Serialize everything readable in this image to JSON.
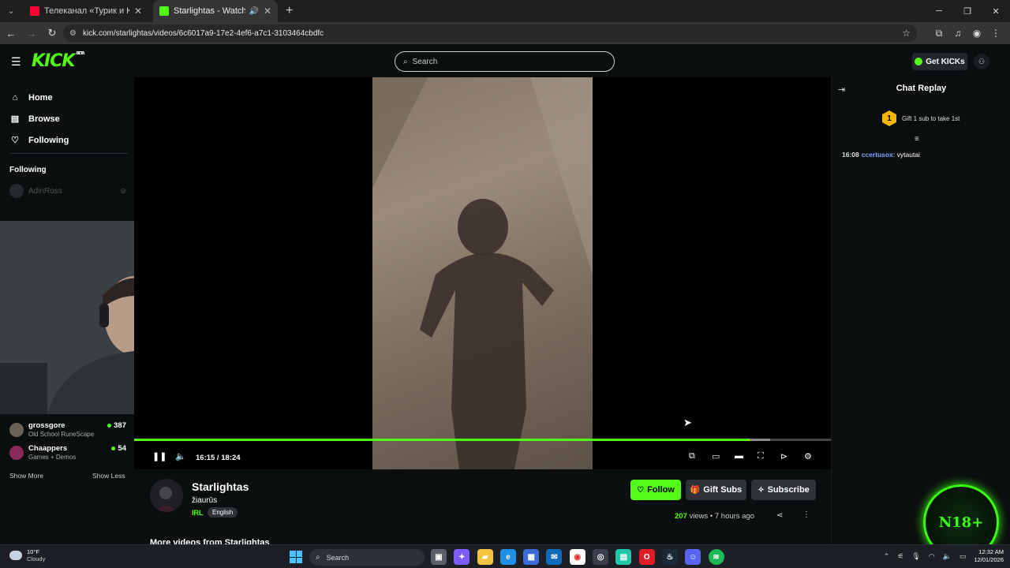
{
  "browser": {
    "tabs": [
      {
        "title": "Телеканал «Турик и Конюшня»",
        "favicon_color": "#ff0033",
        "active": false
      },
      {
        "title": "Starlightas - Watch the VOD",
        "favicon_color": "#53fc18",
        "active": true
      }
    ],
    "url": "kick.com/starlightas/videos/6c6017a9-17e2-4ef6-a7c1-3103464cbdfc"
  },
  "header": {
    "logo": "KICK",
    "logo_badge": "BETA",
    "search_placeholder": "Search",
    "get_kicks_label": "Get KICKs"
  },
  "sidebar": {
    "nav": [
      {
        "label": "Home",
        "icon": "home-icon"
      },
      {
        "label": "Browse",
        "icon": "browse-icon"
      },
      {
        "label": "Following",
        "icon": "heart-icon"
      }
    ],
    "following_title": "Following",
    "following": [
      {
        "name": "AdinRoss",
        "offline": true
      }
    ],
    "recommended": [
      {
        "name": "grossgore",
        "category": "Old School RuneScape",
        "viewers": "387"
      },
      {
        "name": "Chaappers",
        "category": "Games + Demos",
        "viewers": "54"
      }
    ],
    "show_more": "Show More",
    "show_less": "Show Less"
  },
  "player": {
    "current_time": "16:15",
    "duration": "18:24",
    "time_display": "16:15 / 18:24",
    "progress_fraction": 0.883,
    "buffered_fraction": 0.913
  },
  "channel": {
    "name": "Starlightas",
    "stream_title": "žiaurūs",
    "category": "IRL",
    "language": "English",
    "follow_label": "Follow",
    "gift_subs_label": "Gift Subs",
    "subscribe_label": "Subscribe",
    "views_count": "207",
    "views_word": "views",
    "age": "7 hours ago",
    "more_videos_title": "More videos from Starlightas"
  },
  "chat": {
    "title": "Chat Replay",
    "gift_prompt": "Gift 1 sub to take 1st",
    "gift_rank": "1",
    "messages": [
      {
        "time": "16:08",
        "user": "ccertusox",
        "text": "vytautai"
      }
    ]
  },
  "overlay": {
    "badge_text": "N18+"
  },
  "taskbar": {
    "temperature": "10°F",
    "condition": "Cloudy",
    "search_label": "Search",
    "time": "12:32 AM",
    "date": "12/01/2026"
  },
  "colors": {
    "accent": "#53fc18",
    "background": "#0b0e0f",
    "chat_username": "#7aa8ff",
    "gift_badge": "#f5b50a"
  }
}
